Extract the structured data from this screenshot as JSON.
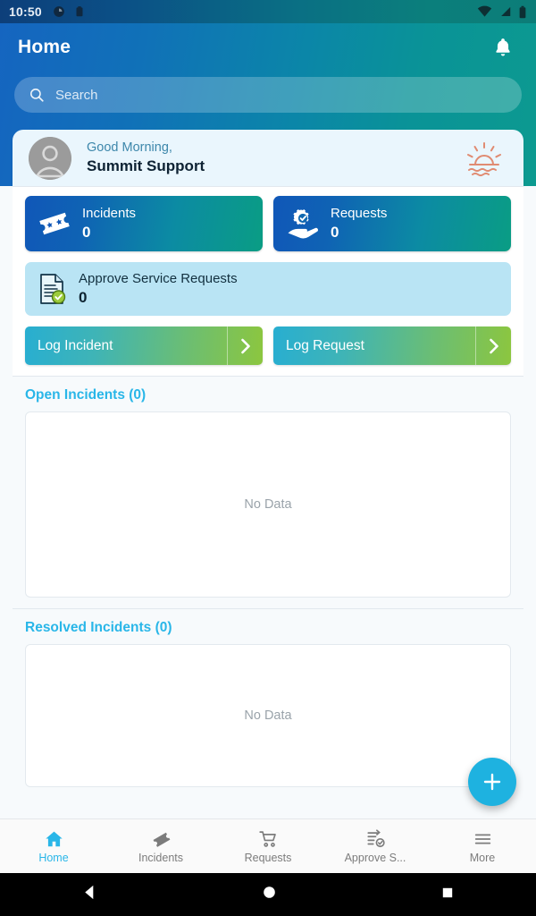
{
  "statusbar": {
    "time": "10:50",
    "left_icons": [
      "app-badge-icon",
      "clipboard-icon"
    ],
    "right_icons": [
      "wifi-icon",
      "cellular-signal-icon",
      "battery-icon"
    ]
  },
  "header": {
    "title": "Home",
    "bell_icon": "notification-bell-icon",
    "gradient_start": "#1565c0",
    "gradient_end": "#0c9a90"
  },
  "search": {
    "placeholder": "Search",
    "icon": "search-icon"
  },
  "greeting": {
    "salutation": "Good Morning,",
    "user": "Summit Support",
    "avatar_icon": "user-avatar-icon",
    "sun_icon": "sunrise-icon",
    "sun_color": "#e08b72"
  },
  "stats": [
    {
      "label": "Incidents",
      "value": "0",
      "icon": "ticket-icon"
    },
    {
      "label": "Requests",
      "value": "0",
      "icon": "gear-hand-icon"
    }
  ],
  "approve": {
    "label": "Approve Service Requests",
    "value": "0",
    "icon": "document-check-icon",
    "bg": "#b9e4f4"
  },
  "log_actions": [
    {
      "label": "Log Incident",
      "arrow_icon": "chevron-right-icon"
    },
    {
      "label": "Log Request",
      "arrow_icon": "chevron-right-icon"
    }
  ],
  "sections": [
    {
      "title": "Open Incidents (0)",
      "empty_text": "No Data"
    },
    {
      "title": "Resolved Incidents (0)",
      "empty_text": "No Data"
    }
  ],
  "fab": {
    "icon": "plus-icon",
    "color": "#1eb2e0"
  },
  "bottom_nav": {
    "active_color": "#29b6e8",
    "items": [
      {
        "label": "Home",
        "icon": "home-icon"
      },
      {
        "label": "Incidents",
        "icon": "ticket-icon"
      },
      {
        "label": "Requests",
        "icon": "shopping-cart-icon"
      },
      {
        "label": "Approve S...",
        "icon": "approval-list-icon"
      },
      {
        "label": "More",
        "icon": "hamburger-menu-icon"
      }
    ]
  },
  "android_nav": {
    "back": "back-triangle-icon",
    "home": "home-circle-icon",
    "recents": "recents-square-icon"
  }
}
